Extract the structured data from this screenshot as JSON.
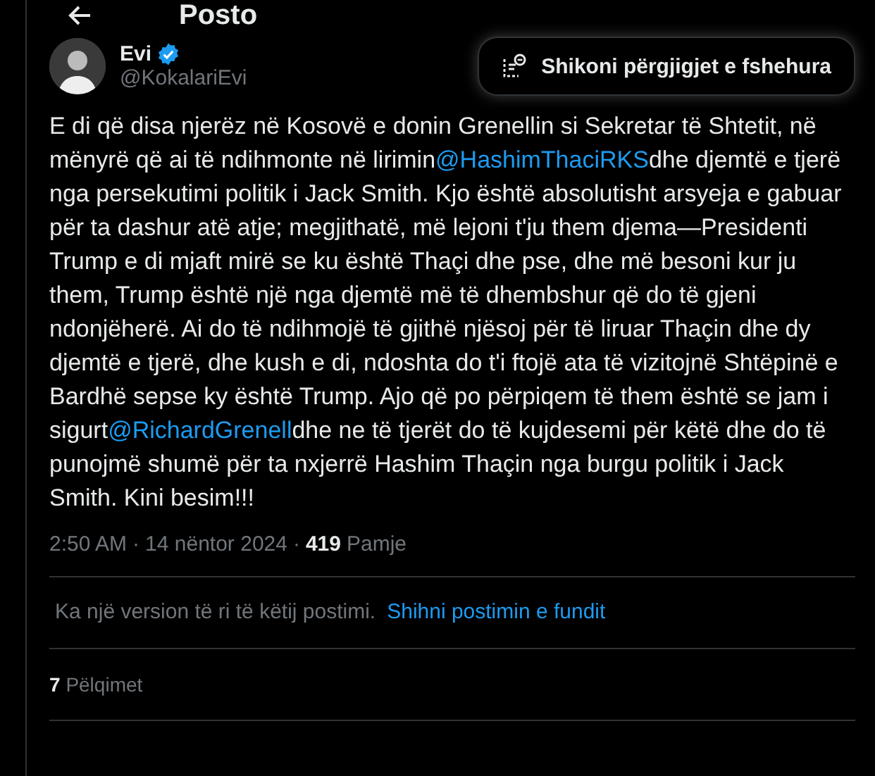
{
  "header": {
    "title": "Posto"
  },
  "author": {
    "name": "Evi",
    "handle": "@KokalariEvi",
    "verified": true
  },
  "hidden_replies_button": {
    "label": "Shikoni përgjigjet e fshehura"
  },
  "post": {
    "segments": [
      {
        "kind": "text",
        "text": "E di që disa njerëz në Kosovë e donin Grenellin si Sekretar të Shtetit, në mënyrë që ai të ndihmonte në lirimin"
      },
      {
        "kind": "mention",
        "text": "@HashimThaciRKS"
      },
      {
        "kind": "text",
        "text": "dhe djemtë e tjerë nga persekutimi politik i Jack Smith. Kjo është absolutisht arsyeja e gabuar për ta dashur atë atje; megjithatë, më lejoni t'ju them djema—Presidenti Trump e di mjaft mirë se ku është Thaçi dhe pse, dhe më besoni kur ju them, Trump është një nga djemtë më të dhembshur që do të gjeni ndonjëherë. Ai do të ndihmojë të gjithë njësoj për të liruar Thaçin dhe dy djemtë e tjerë, dhe kush e di, ndoshta do t'i ftojë ata të vizitojnë Shtëpinë e Bardhë sepse ky është Trump. Ajo që po përpiqem të them është se jam i sigurt"
      },
      {
        "kind": "mention",
        "text": "@RichardGrenell"
      },
      {
        "kind": "text",
        "text": "dhe ne të tjerët do të kujdesemi për këtë dhe do të punojmë shumë për ta nxjerrë Hashim Thaçin nga burgu politik i Jack Smith. Kini besim!!!"
      }
    ]
  },
  "meta": {
    "time": "2:50 AM",
    "separator_1": "·",
    "date": "14 nëntor 2024",
    "separator_2": "·",
    "views_count": "419",
    "views_label": "Pamje"
  },
  "version_notice": {
    "text": "Ka një version të ri të këtij postimi.",
    "link": "Shihni postimin e fundit"
  },
  "likes": {
    "count": "7",
    "label": "Pëlqimet"
  }
}
